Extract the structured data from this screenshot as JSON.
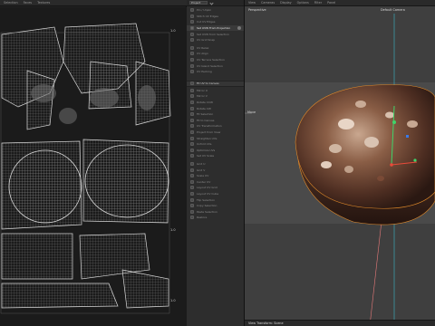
{
  "uv_editor": {
    "menu": [
      "Selection",
      "Faces",
      "Textures"
    ],
    "tick_top": "1.0",
    "tick_right": "1.0",
    "tick_bottom": "1.0"
  },
  "tools": {
    "dropdown": "Project",
    "items": [
      {
        "label": "Pin / Unpin",
        "active": false
      },
      {
        "label": "Stitch UV Edges",
        "active": false
      },
      {
        "label": "Cut UV Edges",
        "active": false
      },
      {
        "label": "Set UVW From Projection",
        "active": true
      },
      {
        "label": "Set UVW from Selection",
        "active": false
      },
      {
        "label": "UV Grid Snap",
        "active": false
      },
      {
        "label": "UV Relax",
        "active": false
      },
      {
        "label": "UV Align",
        "active": false
      },
      {
        "label": "UV Terrace Selection",
        "active": false
      },
      {
        "label": "UV Island Selection",
        "active": false
      },
      {
        "label": "UV Packing",
        "active": false
      }
    ],
    "subhead": "Fit UV to Canvas",
    "items2": [
      {
        "label": "Mirror U"
      },
      {
        "label": "Mirror V"
      },
      {
        "label": "Rotate CCW"
      },
      {
        "label": "Rotate CW"
      },
      {
        "label": "Fit Selection"
      },
      {
        "label": "Fit to Canvas"
      },
      {
        "label": "UV Transformation"
      },
      {
        "label": "Project from View"
      },
      {
        "label": "Straighten UVs"
      },
      {
        "label": "Unfold UVs"
      },
      {
        "label": "Optimize UVs"
      },
      {
        "label": "Set UV Scale"
      }
    ],
    "items3": [
      {
        "label": "Grid U"
      },
      {
        "label": "Grid V"
      },
      {
        "label": "Scale UV"
      },
      {
        "label": "Center UV"
      },
      {
        "label": "Layout UV Grid"
      },
      {
        "label": "Layout UV Cube"
      },
      {
        "label": "Flip Selection"
      },
      {
        "label": "Copy Selection"
      },
      {
        "label": "Paste Selection"
      },
      {
        "label": "Restore"
      }
    ]
  },
  "viewport": {
    "menu": [
      "View",
      "Cameras",
      "Display",
      "Options",
      "Filter",
      "Panel"
    ],
    "view_name": "Perspective",
    "camera_name": "Default Camera",
    "overlay_label": "Move",
    "bottom_label": "View Transform: Scene"
  },
  "colors": {
    "wire": "#d8d8d8",
    "accent_orange": "#e08a2a",
    "axis_green": "#3fd46a",
    "axis_red": "#e84a3a",
    "axis_cyan": "#3ab8c8"
  }
}
